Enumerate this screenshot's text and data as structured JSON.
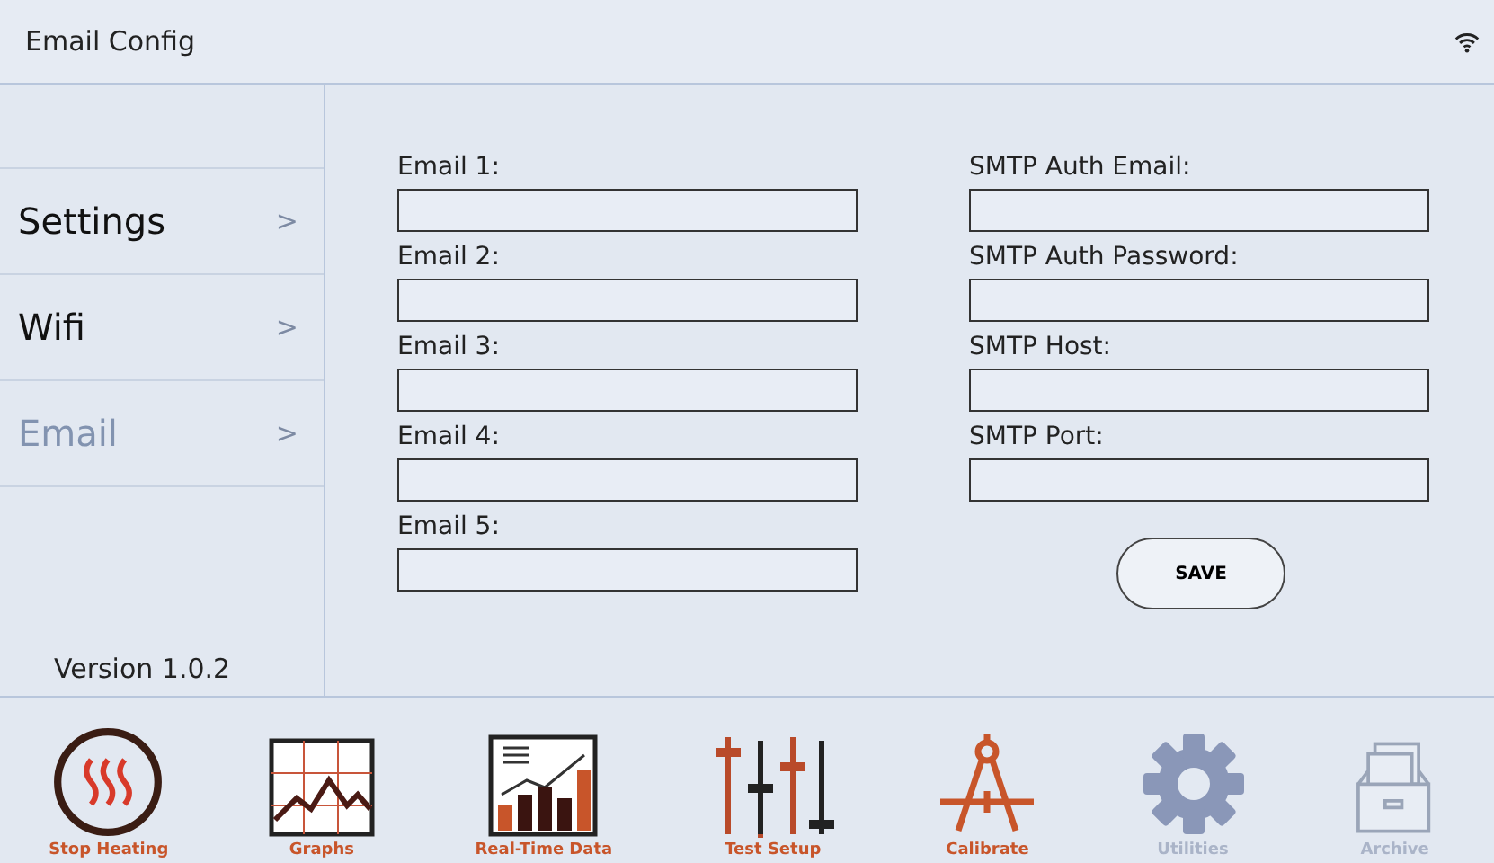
{
  "header": {
    "title": "Email Config"
  },
  "sidebar": {
    "items": [
      {
        "label": "Settings",
        "chevron": ">",
        "selected": false
      },
      {
        "label": "Wifi",
        "chevron": ">",
        "selected": false
      },
      {
        "label": "Email",
        "chevron": ">",
        "selected": true
      }
    ],
    "version": "Version 1.0.2"
  },
  "form": {
    "left_fields": [
      {
        "label": "Email 1:"
      },
      {
        "label": "Email 2:"
      },
      {
        "label": "Email 3:"
      },
      {
        "label": "Email 4:"
      },
      {
        "label": "Email 5:"
      }
    ],
    "right_fields": [
      {
        "label": "SMTP Auth Email:"
      },
      {
        "label": "SMTP Auth Password:"
      },
      {
        "label": "SMTP Host:"
      },
      {
        "label": "SMTP Port:"
      }
    ],
    "save_button": "SAVE"
  },
  "toolbar": [
    {
      "kind": "heating",
      "label": "Stop Heating",
      "disabled": false
    },
    {
      "kind": "graphs",
      "label": "Graphs",
      "disabled": false
    },
    {
      "kind": "realtime",
      "label": "Real-Time Data",
      "disabled": false
    },
    {
      "kind": "test-setup",
      "label": "Test Setup",
      "disabled": false
    },
    {
      "kind": "calibrate",
      "label": "Calibrate",
      "disabled": false
    },
    {
      "kind": "utilities",
      "label": "Utilities",
      "disabled": true
    },
    {
      "kind": "archive",
      "label": "Archive",
      "disabled": true
    }
  ]
}
